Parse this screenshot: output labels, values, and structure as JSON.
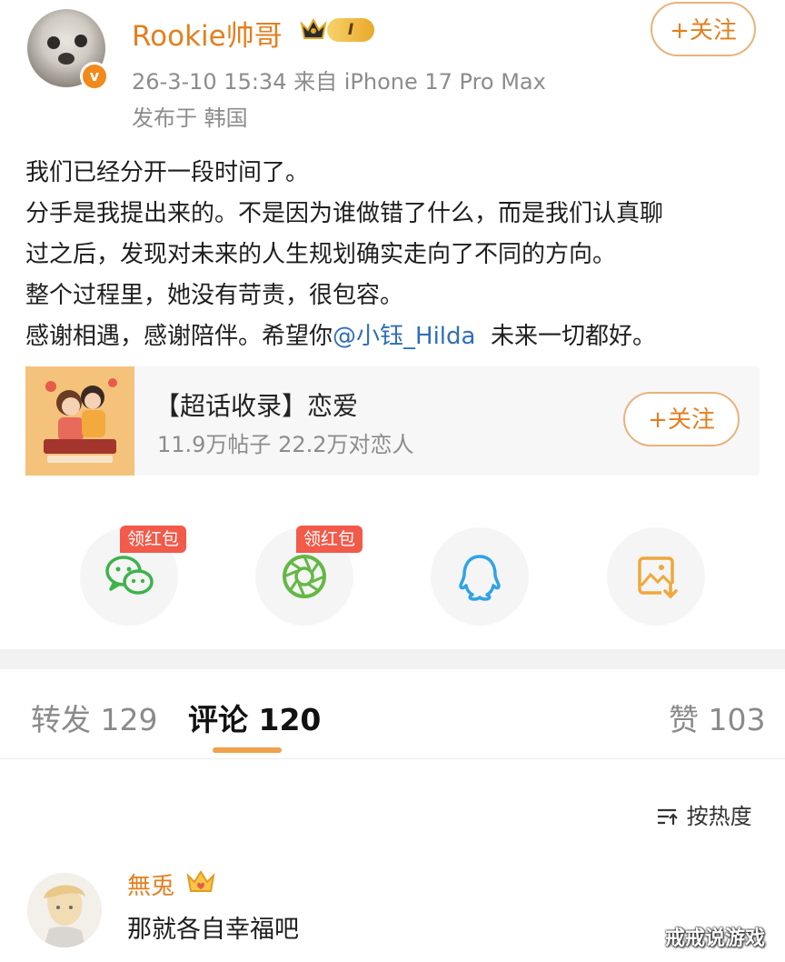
{
  "post": {
    "author": "Rookie帅哥",
    "verified_mark": "v",
    "level_badge": "I",
    "meta_line": "26-3-10 15:34  来自 iPhone 17 Pro Max",
    "location": "发布于 韩国",
    "follow_label": "+关注",
    "lines": [
      "我们已经分开一段时间了。",
      "分手是我提出来的。不是因为谁做错了什么，而是我们认真聊",
      "过之后，发现对未来的人生规划确实走向了不同的方向。",
      "整个过程里，她没有苛责，很包容。"
    ],
    "last_line_before": "感谢相遇，感谢陪伴。希望你",
    "mention": "@小钰_Hilda",
    "last_line_after": "  未来一切都好。"
  },
  "topic": {
    "title": "【超话收录】恋爱",
    "stats": "11.9万帖子 22.2万对恋人",
    "follow_label": "+关注"
  },
  "share": {
    "red_packet_label": "领红包",
    "icons": [
      "wechat-icon",
      "moments-icon",
      "qq-icon",
      "save-image-icon"
    ]
  },
  "tabs": {
    "repost": "转发 129",
    "comments": "评论 120",
    "likes": "赞 103"
  },
  "sort_label": "按热度",
  "comment": {
    "user": "無兎",
    "text": "那就各自幸福吧"
  },
  "watermark": "戒戒说游戏",
  "colors": {
    "accent": "#e47f1e",
    "mention": "#2f6fb3",
    "red_tag": "#f25a4a",
    "tab_underline": "#f0a14a"
  }
}
